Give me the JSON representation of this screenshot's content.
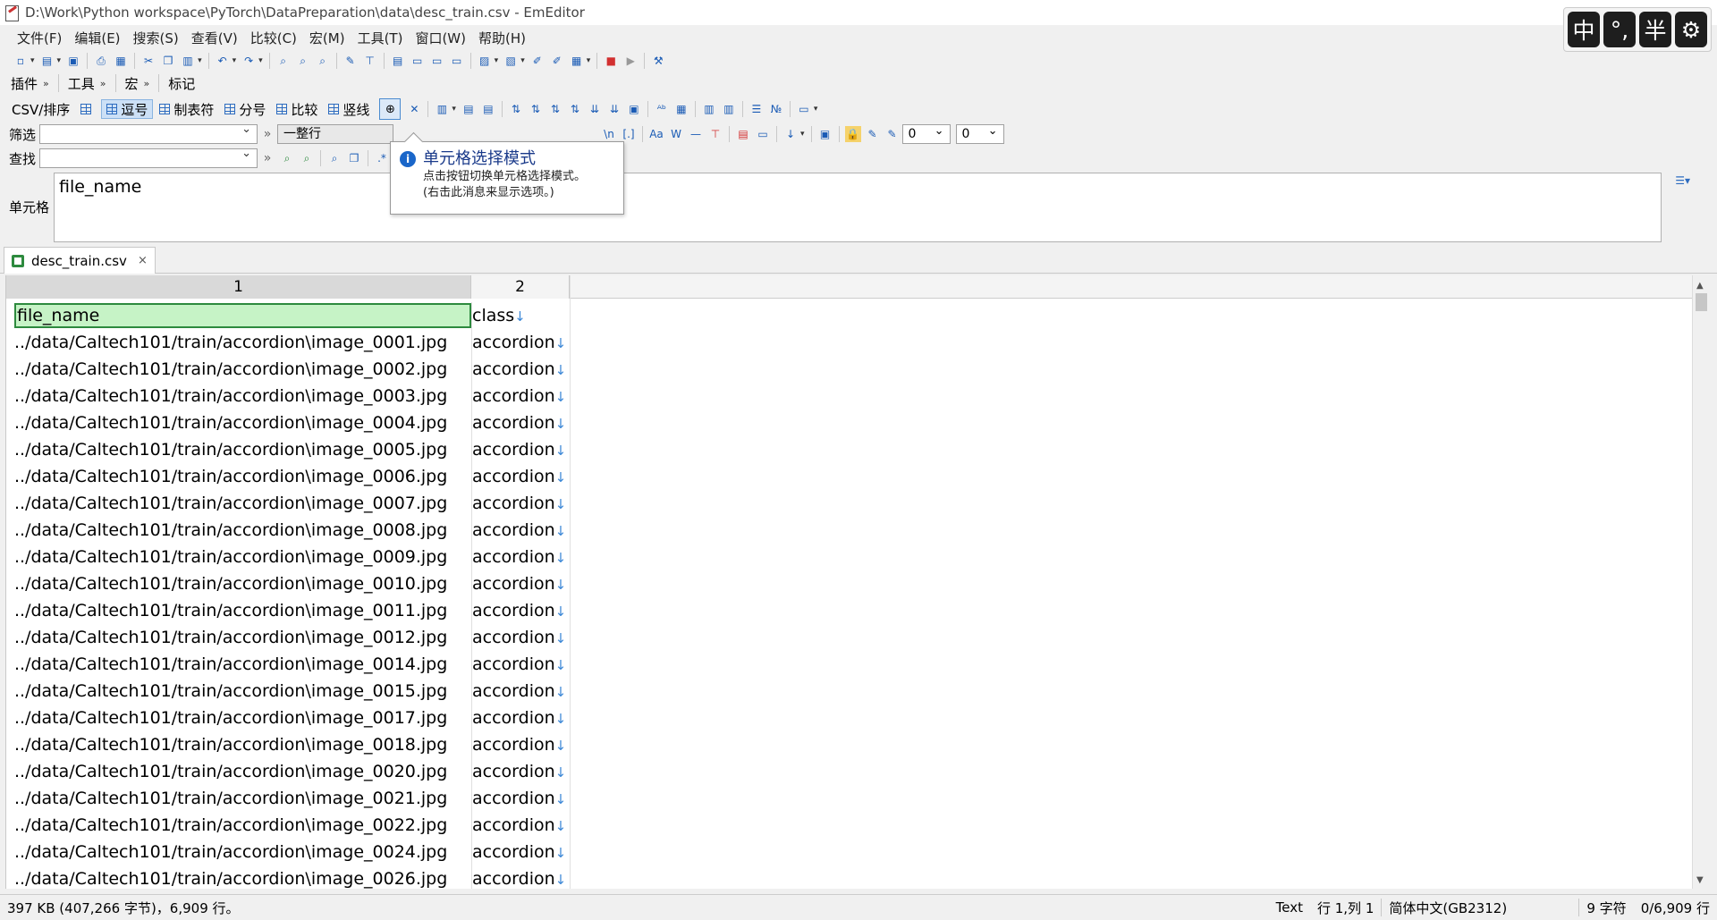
{
  "window": {
    "title": "D:\\Work\\Python workspace\\PyTorch\\DataPreparation\\data\\desc_train.csv - EmEditor"
  },
  "ime": {
    "buttons": [
      "中",
      "°,",
      "半",
      "⚙"
    ]
  },
  "menu": [
    "文件(F)",
    "编辑(E)",
    "搜索(S)",
    "查看(V)",
    "比较(C)",
    "宏(M)",
    "工具(T)",
    "窗口(W)",
    "帮助(H)"
  ],
  "toolbar2": {
    "plugins": "插件",
    "tools": "工具",
    "macros": "宏",
    "marks": "标记"
  },
  "csvbar": {
    "label": "CSV/排序",
    "comma": "逗号",
    "tab": "制表符",
    "semicolon": "分号",
    "compare": "比较",
    "pipe": "竖线"
  },
  "filter": {
    "label": "筛选",
    "mode": "一整行",
    "num1": "0",
    "num2": "0"
  },
  "find": {
    "label": "查找"
  },
  "cell": {
    "label": "单元格",
    "value": "file_name"
  },
  "tooltip": {
    "title": "单元格选择模式",
    "line1": "点击按钮切换单元格选择模式。",
    "line2": "(右击此消息来显示选项。)"
  },
  "tab": {
    "name": "desc_train.csv",
    "close": "×"
  },
  "grid": {
    "headers": [
      "1",
      "2"
    ],
    "eol": "↓",
    "rows": [
      [
        "file_name",
        "class"
      ],
      [
        "../data/Caltech101/train/accordion\\image_0001.jpg",
        "accordion"
      ],
      [
        "../data/Caltech101/train/accordion\\image_0002.jpg",
        "accordion"
      ],
      [
        "../data/Caltech101/train/accordion\\image_0003.jpg",
        "accordion"
      ],
      [
        "../data/Caltech101/train/accordion\\image_0004.jpg",
        "accordion"
      ],
      [
        "../data/Caltech101/train/accordion\\image_0005.jpg",
        "accordion"
      ],
      [
        "../data/Caltech101/train/accordion\\image_0006.jpg",
        "accordion"
      ],
      [
        "../data/Caltech101/train/accordion\\image_0007.jpg",
        "accordion"
      ],
      [
        "../data/Caltech101/train/accordion\\image_0008.jpg",
        "accordion"
      ],
      [
        "../data/Caltech101/train/accordion\\image_0009.jpg",
        "accordion"
      ],
      [
        "../data/Caltech101/train/accordion\\image_0010.jpg",
        "accordion"
      ],
      [
        "../data/Caltech101/train/accordion\\image_0011.jpg",
        "accordion"
      ],
      [
        "../data/Caltech101/train/accordion\\image_0012.jpg",
        "accordion"
      ],
      [
        "../data/Caltech101/train/accordion\\image_0014.jpg",
        "accordion"
      ],
      [
        "../data/Caltech101/train/accordion\\image_0015.jpg",
        "accordion"
      ],
      [
        "../data/Caltech101/train/accordion\\image_0017.jpg",
        "accordion"
      ],
      [
        "../data/Caltech101/train/accordion\\image_0018.jpg",
        "accordion"
      ],
      [
        "../data/Caltech101/train/accordion\\image_0020.jpg",
        "accordion"
      ],
      [
        "../data/Caltech101/train/accordion\\image_0021.jpg",
        "accordion"
      ],
      [
        "../data/Caltech101/train/accordion\\image_0022.jpg",
        "accordion"
      ],
      [
        "../data/Caltech101/train/accordion\\image_0024.jpg",
        "accordion"
      ],
      [
        "../data/Caltech101/train/accordion\\image_0026.jpg",
        "accordion"
      ]
    ]
  },
  "status": {
    "size": "397 KB (407,266 字节)，6,909 行。",
    "mode": "Text",
    "pos": "行 1,列 1",
    "encoding": "简体中文(GB2312)",
    "chars": "9 字符",
    "lines": "0/6,909 行"
  }
}
